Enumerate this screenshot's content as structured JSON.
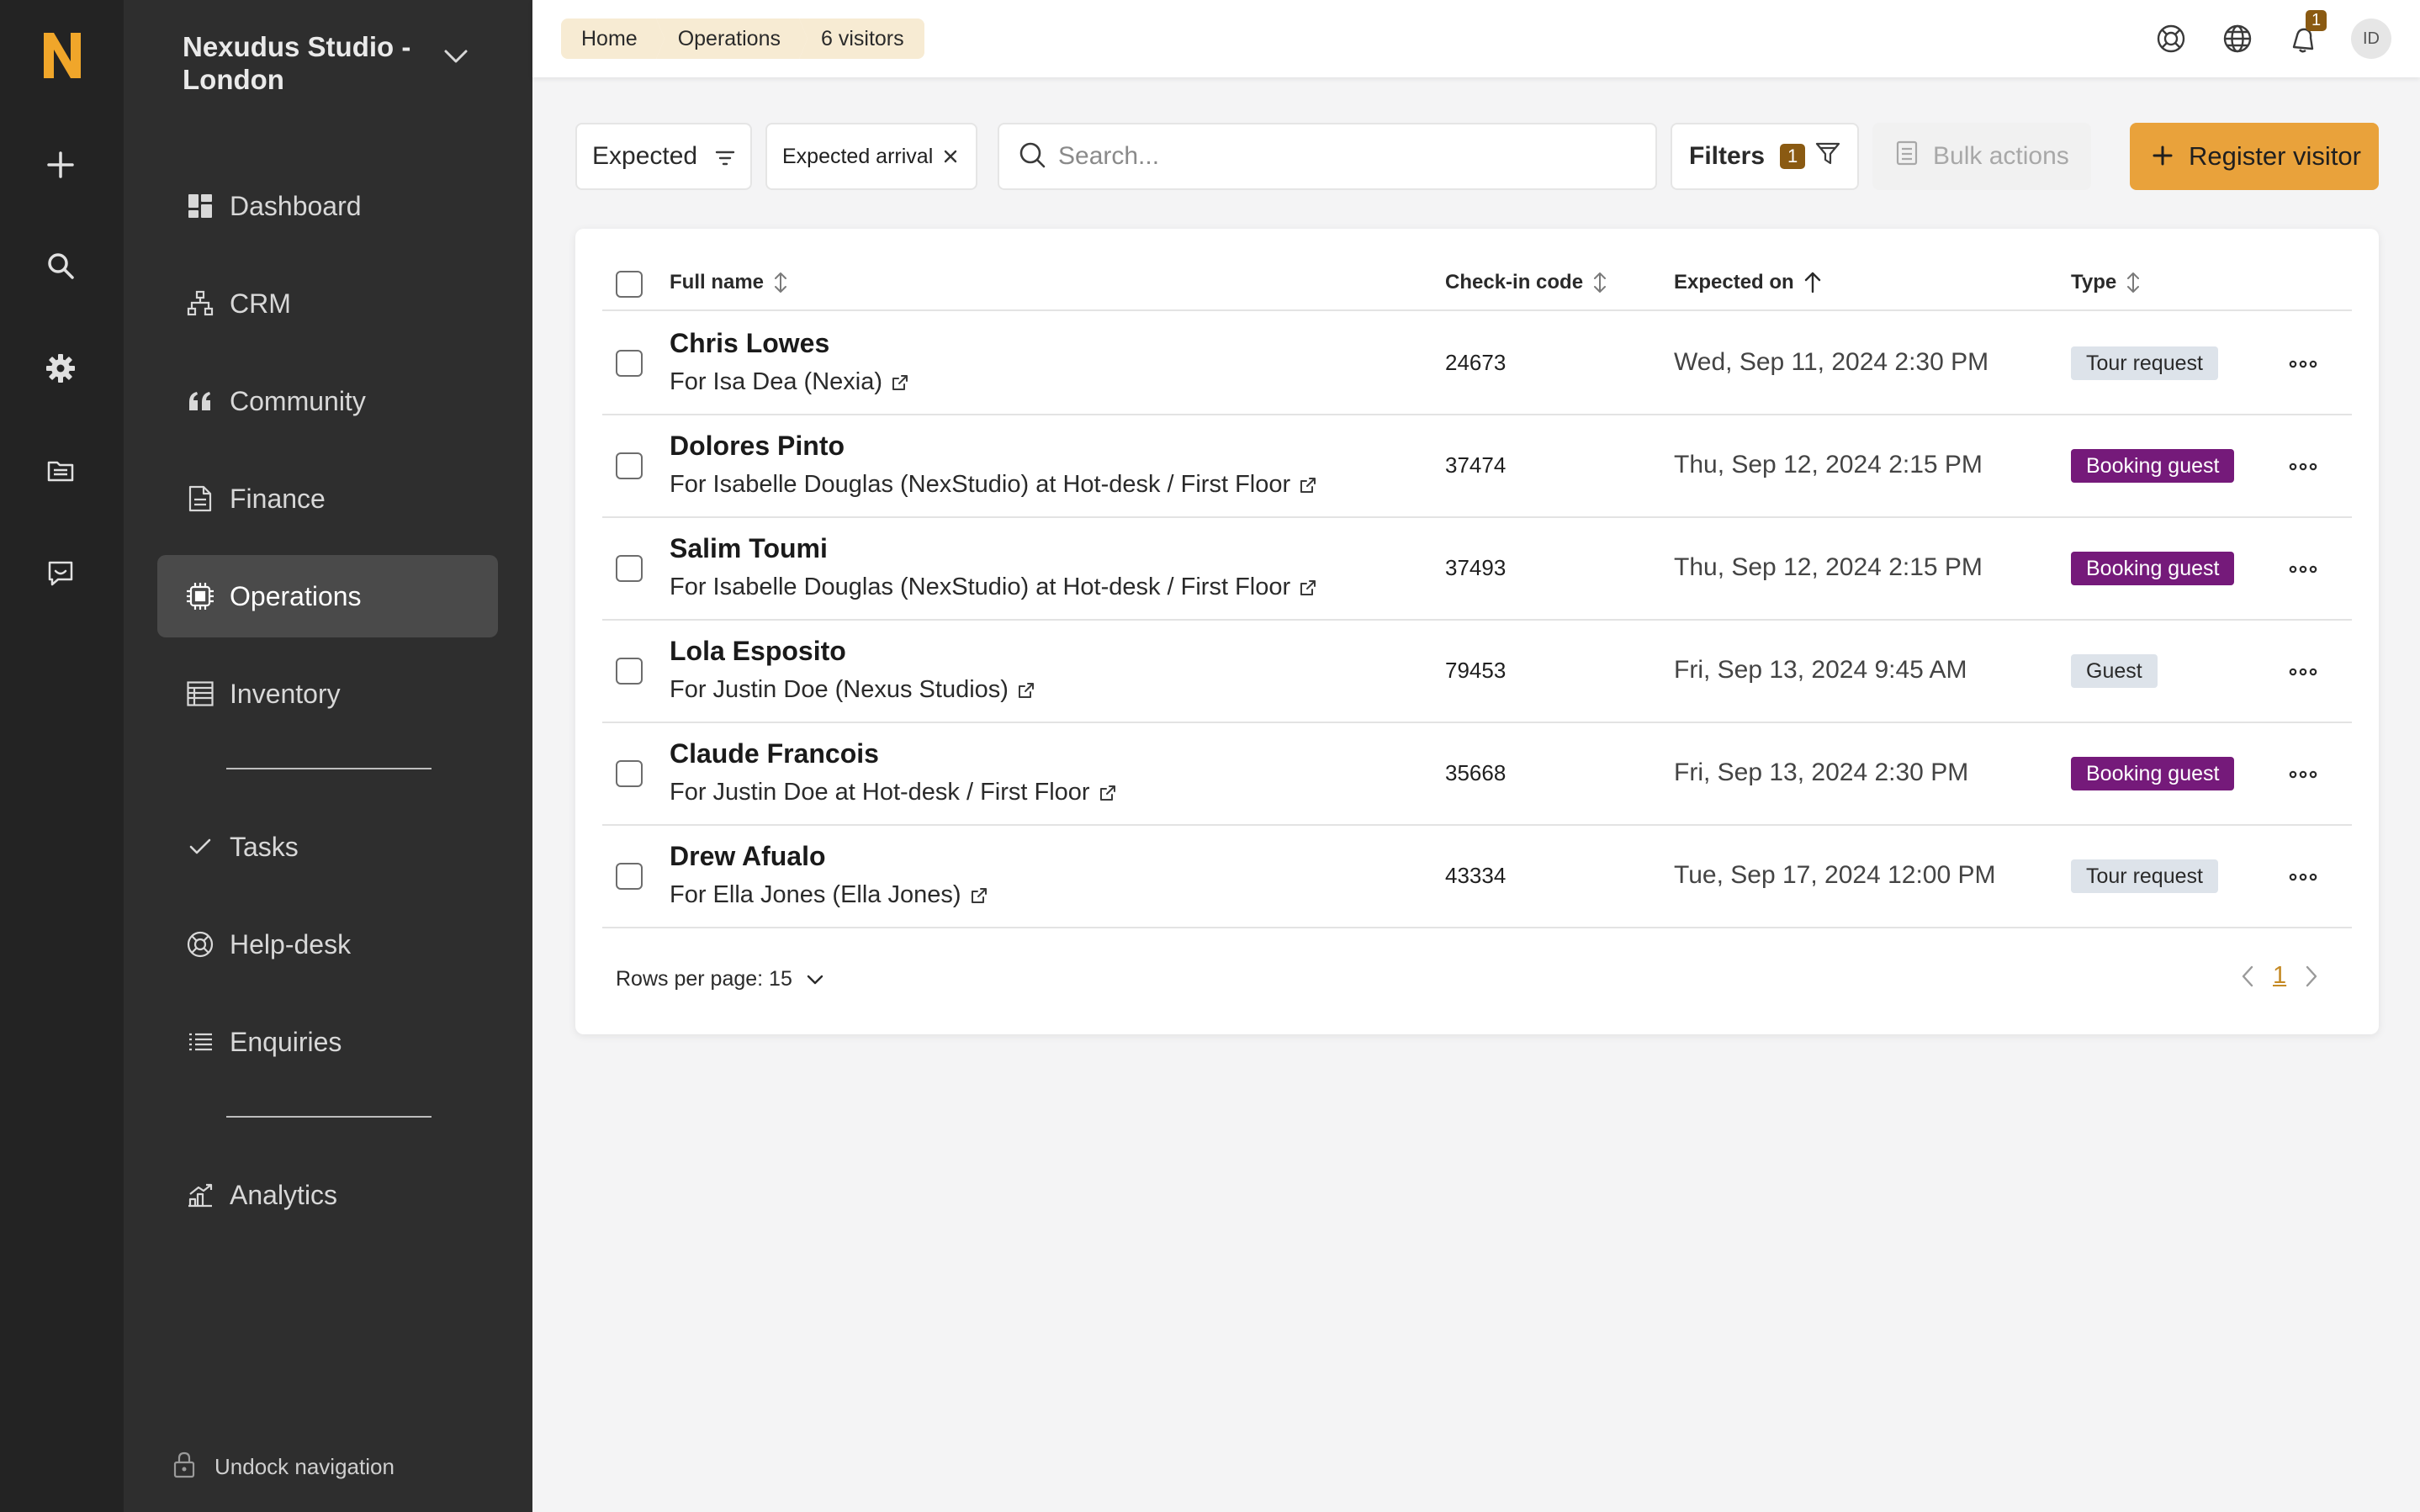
{
  "app": {
    "logo_letter": "N"
  },
  "rail": {
    "icons": [
      "add-icon",
      "search-icon",
      "gear-icon",
      "folder-icon",
      "feedback-icon"
    ]
  },
  "sidebar": {
    "location": "Nexudus Studio - London",
    "items": [
      {
        "label": "Dashboard",
        "icon": "dashboard-icon"
      },
      {
        "label": "CRM",
        "icon": "crm-icon"
      },
      {
        "label": "Community",
        "icon": "quote-icon"
      },
      {
        "label": "Finance",
        "icon": "document-icon"
      },
      {
        "label": "Operations",
        "icon": "chip-icon",
        "active": true
      },
      {
        "label": "Inventory",
        "icon": "table-icon"
      },
      {
        "label": "Tasks",
        "icon": "check-icon"
      },
      {
        "label": "Help-desk",
        "icon": "lifebuoy-icon"
      },
      {
        "label": "Enquiries",
        "icon": "list-icon"
      },
      {
        "label": "Analytics",
        "icon": "chart-icon"
      }
    ],
    "undock_label": "Undock navigation"
  },
  "header": {
    "breadcrumbs": [
      "Home",
      "Operations",
      "6 visitors"
    ],
    "notification_count": "1",
    "avatar_initials": "ID"
  },
  "toolbar": {
    "view_select": "Expected",
    "active_chip": "Expected arrival",
    "search_placeholder": "Search...",
    "filters_label": "Filters",
    "filters_count": "1",
    "bulk_label": "Bulk actions",
    "register_label": "Register visitor"
  },
  "table": {
    "columns": {
      "name": "Full name",
      "code": "Check-in code",
      "expected": "Expected on",
      "type": "Type"
    },
    "rows": [
      {
        "name": "Chris Lowes",
        "sub": "For Isa Dea (Nexia)",
        "code": "24673",
        "date": "Wed, Sep 11, 2024 2:30 PM",
        "type": "Tour request",
        "kind": "tour"
      },
      {
        "name": "Dolores Pinto",
        "sub": "For Isabelle Douglas (NexStudio) at Hot-desk / First Floor",
        "code": "37474",
        "date": "Thu, Sep 12, 2024 2:15 PM",
        "type": "Booking guest",
        "kind": "booking"
      },
      {
        "name": "Salim Toumi",
        "sub": "For Isabelle Douglas (NexStudio) at Hot-desk / First Floor",
        "code": "37493",
        "date": "Thu, Sep 12, 2024 2:15 PM",
        "type": "Booking guest",
        "kind": "booking"
      },
      {
        "name": "Lola Esposito",
        "sub": "For Justin Doe (Nexus Studios)",
        "code": "79453",
        "date": "Fri, Sep 13, 2024 9:45 AM",
        "type": "Guest",
        "kind": "guest"
      },
      {
        "name": "Claude Francois",
        "sub": "For Justin Doe at Hot-desk / First Floor",
        "code": "35668",
        "date": "Fri, Sep 13, 2024 2:30 PM",
        "type": "Booking guest",
        "kind": "booking"
      },
      {
        "name": "Drew Afualo",
        "sub": "For Ella Jones (Ella Jones)",
        "code": "43334",
        "date": "Tue, Sep 17, 2024 12:00 PM",
        "type": "Tour request",
        "kind": "tour"
      }
    ],
    "rows_per_page": "Rows per page: 15",
    "current_page": "1"
  },
  "colors": {
    "accent": "#e9a23b",
    "brand_logo": "#f0a62a",
    "booking_badge": "#751a7a",
    "neutral_badge": "#dde3ea",
    "sidebar_bg": "#2e2e2e",
    "rail_bg": "#232323"
  }
}
